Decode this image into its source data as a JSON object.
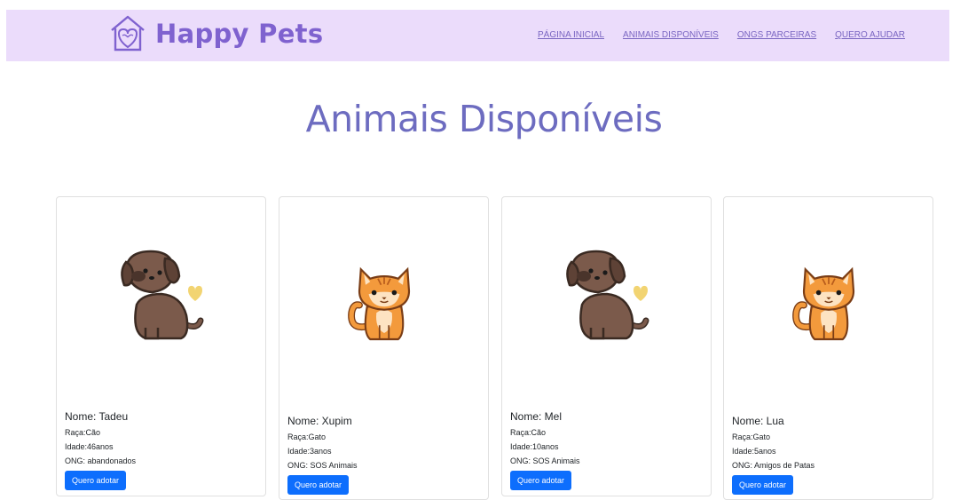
{
  "brand": {
    "name": "Happy Pets",
    "icon": "house-heart-logo-icon"
  },
  "nav": {
    "items": [
      {
        "label": "PÁGINA INICIAL"
      },
      {
        "label": "ANIMAIS DISPONÍVEIS"
      },
      {
        "label": "ONGS PARCEIRAS"
      },
      {
        "label": "QUERO AJUDAR"
      }
    ]
  },
  "main": {
    "title": "Animais Disponíveis"
  },
  "cards": [
    {
      "name": "Nome: Tadeu",
      "breed": "Raça:Cão",
      "age": "Idade:46anos",
      "ong": "ONG: abandonados",
      "button": "Quero adotar",
      "image": "dog-illustration"
    },
    {
      "name": "Nome: Xupim",
      "breed": "Raça:Gato",
      "age": "Idade:3anos",
      "ong": "ONG: SOS Animais",
      "button": "Quero adotar",
      "image": "cat-illustration"
    },
    {
      "name": "Nome: Mel",
      "breed": "Raça:Cão",
      "age": "Idade:10anos",
      "ong": "ONG: SOS Animais",
      "button": "Quero adotar",
      "image": "dog-illustration"
    },
    {
      "name": "Nome: Lua",
      "breed": "Raça:Gato",
      "age": "Idade:5anos",
      "ong": "ONG: Amigos de Patas",
      "button": "Quero adotar",
      "image": "cat-illustration"
    }
  ],
  "colors": {
    "nav_bg": "#ebdcfb",
    "brand": "#7f62cf",
    "title": "#6d6cc0",
    "button": "#0d6efd"
  }
}
